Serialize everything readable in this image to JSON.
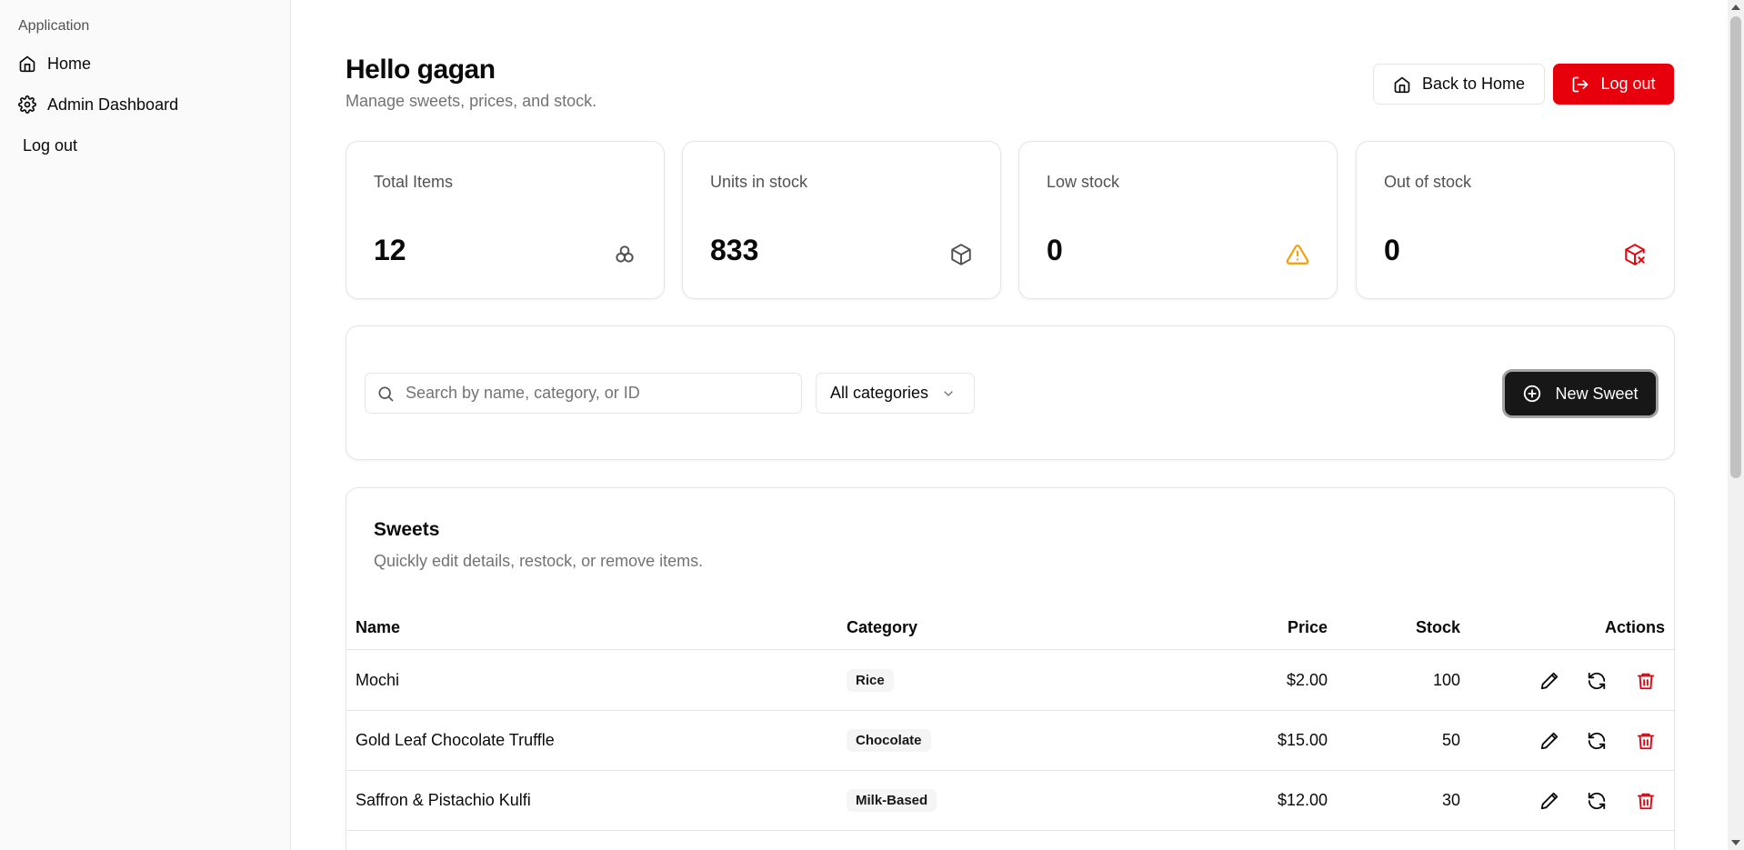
{
  "sidebar": {
    "group_label": "Application",
    "items": [
      {
        "label": "Home",
        "icon": "home-icon"
      },
      {
        "label": "Admin Dashboard",
        "icon": "gear-icon"
      },
      {
        "label": "Log out"
      }
    ]
  },
  "header": {
    "title": "Hello gagan",
    "subtitle": "Manage sweets, prices, and stock.",
    "back_label": "Back to Home",
    "logout_label": "Log out"
  },
  "stats": [
    {
      "label": "Total Items",
      "value": "12",
      "icon": "boxes-icon"
    },
    {
      "label": "Units in stock",
      "value": "833",
      "icon": "package-icon"
    },
    {
      "label": "Low stock",
      "value": "0",
      "icon": "warning-triangle-icon"
    },
    {
      "label": "Out of stock",
      "value": "0",
      "icon": "package-x-icon"
    }
  ],
  "filters": {
    "search_placeholder": "Search by name, category, or ID",
    "category_selected": "All categories",
    "new_label": "New Sweet"
  },
  "table": {
    "title": "Sweets",
    "description": "Quickly edit details, restock, or remove items.",
    "columns": [
      "Name",
      "Category",
      "Price",
      "Stock",
      "Actions"
    ],
    "rows": [
      {
        "name": "Mochi",
        "category": "Rice",
        "price": "$2.00",
        "stock": "100"
      },
      {
        "name": "Gold Leaf Chocolate Truffle",
        "category": "Chocolate",
        "price": "$15.00",
        "stock": "50"
      },
      {
        "name": "Saffron & Pistachio Kulfi",
        "category": "Milk-Based",
        "price": "$12.00",
        "stock": "30"
      }
    ]
  },
  "colors": {
    "accent_red": "#e7000b",
    "warning": "#f59e0b",
    "primary_dark": "#171717",
    "muted_text": "#737373",
    "border": "#e5e5e5"
  }
}
